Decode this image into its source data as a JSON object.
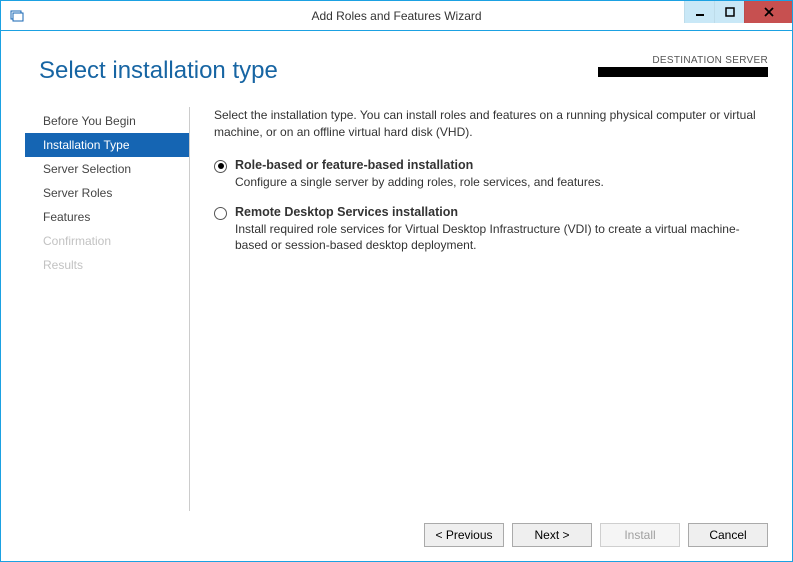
{
  "window": {
    "title": "Add Roles and Features Wizard"
  },
  "header": {
    "page_title": "Select installation type",
    "destination_label": "DESTINATION SERVER"
  },
  "sidebar": {
    "items": [
      {
        "label": "Before You Begin",
        "state": "normal"
      },
      {
        "label": "Installation Type",
        "state": "active"
      },
      {
        "label": "Server Selection",
        "state": "normal"
      },
      {
        "label": "Server Roles",
        "state": "normal"
      },
      {
        "label": "Features",
        "state": "normal"
      },
      {
        "label": "Confirmation",
        "state": "disabled"
      },
      {
        "label": "Results",
        "state": "disabled"
      }
    ]
  },
  "main": {
    "intro": "Select the installation type. You can install roles and features on a running physical computer or virtual machine, or on an offline virtual hard disk (VHD).",
    "options": [
      {
        "title": "Role-based or feature-based installation",
        "desc": "Configure a single server by adding roles, role services, and features.",
        "selected": true
      },
      {
        "title": "Remote Desktop Services installation",
        "desc": "Install required role services for Virtual Desktop Infrastructure (VDI) to create a virtual machine-based or session-based desktop deployment.",
        "selected": false
      }
    ]
  },
  "footer": {
    "previous": "< Previous",
    "next": "Next >",
    "install": "Install",
    "cancel": "Cancel"
  }
}
